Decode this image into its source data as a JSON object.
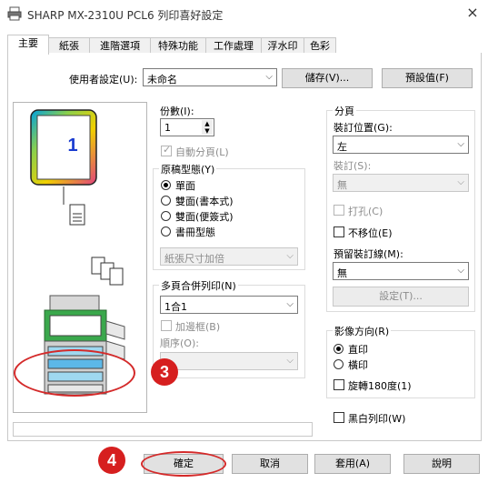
{
  "window": {
    "title": "SHARP MX-2310U PCL6 列印喜好設定",
    "close": "×"
  },
  "tabs": [
    "主要",
    "紙張",
    "進階選項",
    "特殊功能",
    "工作處理",
    "浮水印",
    "色彩"
  ],
  "user_settings": {
    "label": "使用者設定(U):",
    "value": "未命名",
    "save": "儲存(V)...",
    "default": "預設值(F)"
  },
  "preview": {
    "page_number": "1"
  },
  "copies": {
    "label": "份數(I):",
    "value": "1",
    "collate": "自動分頁(L)"
  },
  "original_type": {
    "title": "原稿型態(Y)",
    "options": [
      "單面",
      "雙面(書本式)",
      "雙面(便簽式)",
      "書冊型態"
    ],
    "selected": 0,
    "paper_size": "紙張尺寸加倍"
  },
  "nup": {
    "title": "多頁合併列印(N)",
    "value": "1合1",
    "border": "加邊框(B)",
    "order_label": "順序(O):"
  },
  "pagination": {
    "title": "分頁",
    "binding_position_label": "裝訂位置(G):",
    "binding_position_value": "左",
    "staple_label": "裝訂(S):",
    "staple_value": "無",
    "punch": "打孔(C)",
    "no_offset": "不移位(E)",
    "gutter_label": "預留裝訂線(M):",
    "gutter_value": "無",
    "settings_button": "設定(T)..."
  },
  "orientation": {
    "title": "影像方向(R)",
    "options": [
      "直印",
      "橫印"
    ],
    "selected": 0,
    "rotate": "旋轉180度(1)"
  },
  "bw_print": "黑白列印(W)",
  "footer": {
    "ok": "確定",
    "cancel": "取消",
    "apply": "套用(A)",
    "help": "說明"
  },
  "annotations": {
    "badge3": "3",
    "badge4": "4",
    "color": "#d61f1f"
  }
}
